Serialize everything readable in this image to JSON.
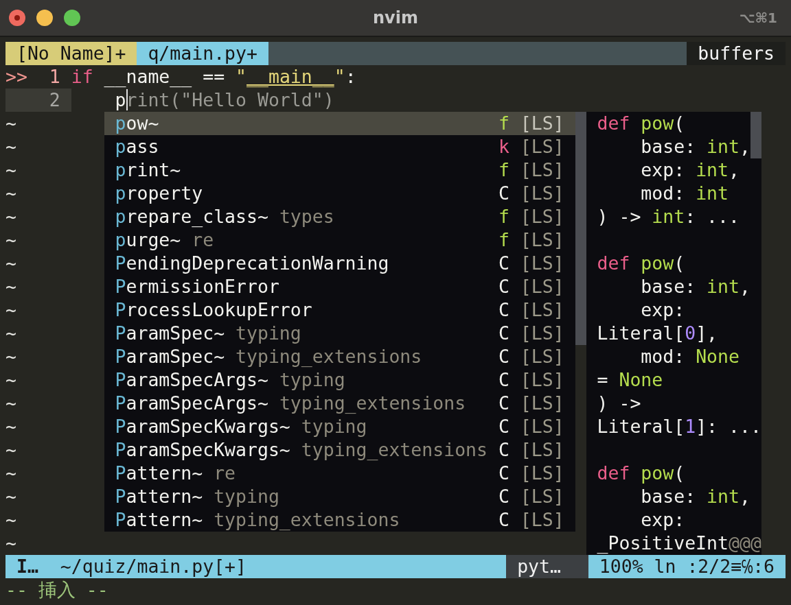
{
  "window": {
    "title": "nvim",
    "shortcut": "⌥⌘1"
  },
  "tabline": {
    "tabs": [
      {
        "label": "[No Name]+",
        "selected": false
      },
      {
        "label": "q/main.py+",
        "selected": true
      }
    ],
    "right": "buffers"
  },
  "lines": [
    {
      "sign": ">>",
      "number": "1",
      "current": false,
      "tokens": [
        {
          "text": "if",
          "kind": "keyword",
          "cursor": false
        },
        {
          "text": " __name__ == ",
          "kind": "plain",
          "cursor": false
        },
        {
          "text": "\"",
          "kind": "string",
          "cursor": false
        },
        {
          "text": "__main__",
          "kind": "string_underlined",
          "cursor": false
        },
        {
          "text": "\"",
          "kind": "string",
          "cursor": false
        },
        {
          "text": ":",
          "kind": "plain",
          "cursor": false
        }
      ]
    },
    {
      "number": "2",
      "current": true,
      "tokens": [
        {
          "text": "    p",
          "kind": "plain",
          "cursor": false
        },
        {
          "text": "rint(\"Hello World\")",
          "kind": "ghost",
          "cursor": true
        }
      ]
    }
  ],
  "tildes": [
    "~",
    "~",
    "~",
    "~",
    "~",
    "~",
    "~",
    "~",
    "~",
    "~",
    "~",
    "~",
    "~",
    "~",
    "~",
    "~",
    "~",
    "~",
    "~"
  ],
  "popup": {
    "items": [
      {
        "match": "p",
        "rest": "ow~",
        "kind": "f",
        "source": "[LS]",
        "selected": true
      },
      {
        "match": "p",
        "rest": "ass",
        "kind": "k",
        "source": "[LS]",
        "selected": false
      },
      {
        "match": "p",
        "rest": "rint~",
        "kind": "f",
        "source": "[LS]",
        "selected": false
      },
      {
        "match": "p",
        "rest": "roperty",
        "kind": "C",
        "source": "[LS]",
        "selected": false
      },
      {
        "match": "p",
        "rest": "repare_class~",
        "menu": "types",
        "kind": "f",
        "source": "[LS]",
        "selected": false
      },
      {
        "match": "p",
        "rest": "urge~",
        "menu": "re",
        "kind": "f",
        "source": "[LS]",
        "selected": false
      },
      {
        "match": "P",
        "rest": "endingDeprecationWarning",
        "kind": "C",
        "source": "[LS]",
        "selected": false
      },
      {
        "match": "P",
        "rest": "ermissionError",
        "kind": "C",
        "source": "[LS]",
        "selected": false
      },
      {
        "match": "P",
        "rest": "rocessLookupError",
        "kind": "C",
        "source": "[LS]",
        "selected": false
      },
      {
        "match": "P",
        "rest": "aramSpec~",
        "menu": "typing",
        "kind": "C",
        "source": "[LS]",
        "selected": false
      },
      {
        "match": "P",
        "rest": "aramSpec~",
        "menu": "typing_extensions",
        "kind": "C",
        "source": "[LS]",
        "selected": false
      },
      {
        "match": "P",
        "rest": "aramSpecArgs~",
        "menu": "typing",
        "kind": "C",
        "source": "[LS]",
        "selected": false
      },
      {
        "match": "P",
        "rest": "aramSpecArgs~",
        "menu": "typing_extensions",
        "kind": "C",
        "source": "[LS]",
        "selected": false
      },
      {
        "match": "P",
        "rest": "aramSpecKwargs~",
        "menu": "typing",
        "kind": "C",
        "source": "[LS]",
        "selected": false
      },
      {
        "match": "P",
        "rest": "aramSpecKwargs~",
        "menu": "typing_extensions",
        "kind": "C",
        "source": "[LS]",
        "selected": false
      },
      {
        "match": "P",
        "rest": "attern~",
        "menu": "re",
        "kind": "C",
        "source": "[LS]",
        "selected": false
      },
      {
        "match": "P",
        "rest": "attern~",
        "menu": "typing",
        "kind": "C",
        "source": "[LS]",
        "selected": false
      },
      {
        "match": "P",
        "rest": "attern~",
        "menu": "typing_extensions",
        "kind": "C",
        "source": "[LS]",
        "selected": false
      }
    ]
  },
  "doc": {
    "signatures": [
      {
        "lines": [
          [
            {
              "text": "def ",
              "kind": "keyword"
            },
            {
              "text": "pow",
              "kind": "function"
            },
            {
              "text": "(",
              "kind": "plain"
            }
          ],
          [
            {
              "text": "    base: ",
              "kind": "plain"
            },
            {
              "text": "int",
              "kind": "type"
            },
            {
              "text": ",",
              "kind": "plain"
            }
          ],
          [
            {
              "text": "    exp: ",
              "kind": "plain"
            },
            {
              "text": "int",
              "kind": "type"
            },
            {
              "text": ",",
              "kind": "plain"
            }
          ],
          [
            {
              "text": "    mod: ",
              "kind": "plain"
            },
            {
              "text": "int",
              "kind": "type"
            }
          ],
          [
            {
              "text": ") -> ",
              "kind": "plain"
            },
            {
              "text": "int",
              "kind": "type"
            },
            {
              "text": ": ...",
              "kind": "plain"
            }
          ]
        ]
      },
      {
        "lines": [
          [
            {
              "text": "def ",
              "kind": "keyword"
            },
            {
              "text": "pow",
              "kind": "function"
            },
            {
              "text": "(",
              "kind": "plain"
            }
          ],
          [
            {
              "text": "    base: ",
              "kind": "plain"
            },
            {
              "text": "int",
              "kind": "type"
            },
            {
              "text": ",",
              "kind": "plain"
            }
          ],
          [
            {
              "text": "    exp:",
              "kind": "plain"
            }
          ],
          [
            {
              "text": "Literal[",
              "kind": "plain"
            },
            {
              "text": "0",
              "kind": "number"
            },
            {
              "text": "],",
              "kind": "plain"
            }
          ],
          [
            {
              "text": "    mod: ",
              "kind": "plain"
            },
            {
              "text": "None",
              "kind": "type"
            }
          ],
          [
            {
              "text": "= ",
              "kind": "plain"
            },
            {
              "text": "None",
              "kind": "type"
            }
          ],
          [
            {
              "text": ") ->",
              "kind": "plain"
            }
          ],
          [
            {
              "text": "Literal[",
              "kind": "plain"
            },
            {
              "text": "1",
              "kind": "number"
            },
            {
              "text": "]: ...",
              "kind": "plain"
            }
          ]
        ]
      },
      {
        "lines": [
          [
            {
              "text": "def ",
              "kind": "keyword"
            },
            {
              "text": "pow",
              "kind": "function"
            },
            {
              "text": "(",
              "kind": "plain"
            }
          ],
          [
            {
              "text": "    base: ",
              "kind": "plain"
            },
            {
              "text": "int",
              "kind": "type"
            },
            {
              "text": ",",
              "kind": "plain"
            }
          ],
          [
            {
              "text": "    exp:",
              "kind": "plain"
            }
          ],
          [
            {
              "text": "_PositiveInt",
              "kind": "plain"
            },
            {
              "text": "@@@",
              "kind": "dim"
            }
          ]
        ]
      }
    ]
  },
  "statusline": {
    "mode": "I…",
    "file": "~/quiz/main.py[+]",
    "filetype": "pyt…",
    "percent": "100%",
    "position": "ln :2/2≡℅:6"
  },
  "cmdline": "-- 挿入 --"
}
